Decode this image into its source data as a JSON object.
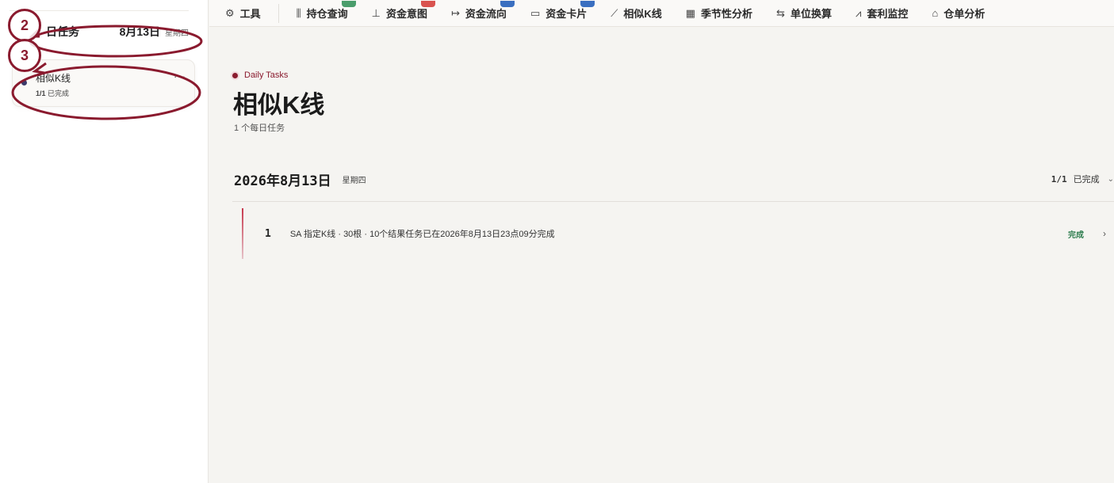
{
  "sidebar": {
    "header": {
      "title": "日任务",
      "date": "8月13日",
      "weekday": "星期四"
    },
    "task_card": {
      "name": "相似K线",
      "progress_count": "1/1",
      "progress_label": "已完成",
      "more": "···"
    }
  },
  "annotations": {
    "badge_2": "2",
    "badge_3": "3",
    "color": "#8a1a2e"
  },
  "toolbar": {
    "tools": {
      "label": "工具",
      "icon": "gear-icon"
    },
    "items": [
      {
        "label": "持仓查询",
        "icon": "bar-chart-icon",
        "flag": "#4a9d6b"
      },
      {
        "label": "资金意图",
        "icon": "column-chart-icon",
        "flag": "#d9534f"
      },
      {
        "label": "资金流向",
        "icon": "flow-arrow-icon",
        "flag": "#3a6fc0"
      },
      {
        "label": "资金卡片",
        "icon": "card-icon",
        "flag": "#3a6fc0"
      },
      {
        "label": "相似K线",
        "icon": "trend-line-icon",
        "flag": ""
      },
      {
        "label": "季节性分析",
        "icon": "calendar-icon",
        "flag": ""
      },
      {
        "label": "单位换算",
        "icon": "swap-icon",
        "flag": ""
      },
      {
        "label": "套利监控",
        "icon": "line-chart-icon",
        "flag": ""
      },
      {
        "label": "仓单分析",
        "icon": "warehouse-icon",
        "flag": ""
      }
    ]
  },
  "main": {
    "eyebrow": "Daily Tasks",
    "title": "相似K线",
    "subtitle": "1 个每日任务",
    "date_group": {
      "date": "2026年8月13日",
      "weekday": "星期四",
      "summary_count": "1/1",
      "summary_label": "已完成"
    },
    "rows": [
      {
        "index": "1",
        "description": "SA 指定K线 · 30根 · 10个结果任务已在2026年8月13日23点09分完成",
        "status": "完成"
      }
    ]
  }
}
